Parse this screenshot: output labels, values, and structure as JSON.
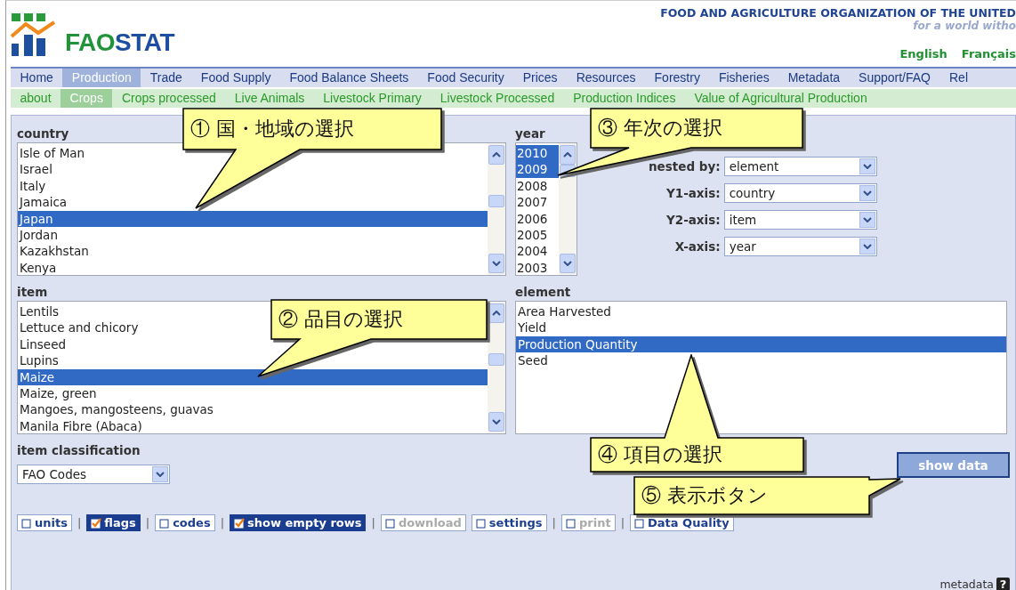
{
  "header": {
    "logo_text": [
      "FAO",
      "STAT"
    ],
    "organization": "FOOD AND AGRICULTURE ORGANIZATION OF THE UNITED",
    "tagline": "for a world witho",
    "languages": [
      {
        "label": "English"
      },
      {
        "label": "Français"
      }
    ]
  },
  "nav": [
    {
      "label": "Home",
      "selected": false
    },
    {
      "label": "Production",
      "selected": true
    },
    {
      "label": "Trade",
      "selected": false
    },
    {
      "label": "Food Supply",
      "selected": false
    },
    {
      "label": "Food Balance Sheets",
      "selected": false
    },
    {
      "label": "Food Security",
      "selected": false
    },
    {
      "label": "Prices",
      "selected": false
    },
    {
      "label": "Resources",
      "selected": false
    },
    {
      "label": "Forestry",
      "selected": false
    },
    {
      "label": "Fisheries",
      "selected": false
    },
    {
      "label": "Metadata",
      "selected": false
    },
    {
      "label": "Support/FAQ",
      "selected": false
    },
    {
      "label": "Rel",
      "selected": false
    }
  ],
  "subnav": [
    {
      "label": "about",
      "selected": false
    },
    {
      "label": "Crops",
      "selected": true
    },
    {
      "label": "Crops processed",
      "selected": false
    },
    {
      "label": "Live Animals",
      "selected": false
    },
    {
      "label": "Livestock Primary",
      "selected": false
    },
    {
      "label": "Livestock Processed",
      "selected": false
    },
    {
      "label": "Production Indices",
      "selected": false
    },
    {
      "label": "Value of Agricultural Production",
      "selected": false
    }
  ],
  "country": {
    "label": "country",
    "items": [
      {
        "label": "Isle of Man",
        "selected": false
      },
      {
        "label": "Israel",
        "selected": false
      },
      {
        "label": "Italy",
        "selected": false
      },
      {
        "label": "Jamaica",
        "selected": false
      },
      {
        "label": "Japan",
        "selected": true
      },
      {
        "label": "Jordan",
        "selected": false
      },
      {
        "label": "Kazakhstan",
        "selected": false
      },
      {
        "label": "Kenya",
        "selected": false
      }
    ]
  },
  "year": {
    "label": "year",
    "items": [
      {
        "label": "2010",
        "selected": true
      },
      {
        "label": "2009",
        "selected": true
      },
      {
        "label": "2008",
        "selected": false
      },
      {
        "label": "2007",
        "selected": false
      },
      {
        "label": "2006",
        "selected": false
      },
      {
        "label": "2005",
        "selected": false
      },
      {
        "label": "2004",
        "selected": false
      },
      {
        "label": "2003",
        "selected": false
      }
    ]
  },
  "axes": [
    {
      "label": "nested by:",
      "value": "element"
    },
    {
      "label": "Y1-axis:",
      "value": "country"
    },
    {
      "label": "Y2-axis:",
      "value": "item"
    },
    {
      "label": "X-axis:",
      "value": "year"
    }
  ],
  "item": {
    "label": "item",
    "items": [
      {
        "label": "Lentils",
        "selected": false
      },
      {
        "label": "Lettuce and chicory",
        "selected": false
      },
      {
        "label": "Linseed",
        "selected": false
      },
      {
        "label": "Lupins",
        "selected": false
      },
      {
        "label": "Maize",
        "selected": true
      },
      {
        "label": "Maize, green",
        "selected": false
      },
      {
        "label": "Mangoes, mangosteens, guavas",
        "selected": false
      },
      {
        "label": "Manila Fibre (Abaca)",
        "selected": false
      }
    ]
  },
  "element": {
    "label": "element",
    "items": [
      {
        "label": "Area Harvested",
        "selected": false
      },
      {
        "label": "Yield",
        "selected": false
      },
      {
        "label": "Production Quantity",
        "selected": true
      },
      {
        "label": "Seed",
        "selected": false
      }
    ]
  },
  "classification": {
    "label": "item classification",
    "value": "FAO Codes"
  },
  "show_data": "show data",
  "options": [
    {
      "label": "units",
      "checked": false,
      "disabled": false,
      "separator": "|"
    },
    {
      "label": "flags",
      "checked": true,
      "disabled": false,
      "separator": "|"
    },
    {
      "label": "codes",
      "checked": false,
      "disabled": false,
      "separator": "|"
    },
    {
      "label": "show empty rows",
      "checked": true,
      "disabled": false,
      "separator": "|"
    },
    {
      "label": "download",
      "checked": false,
      "disabled": true
    },
    {
      "label": "settings",
      "checked": false,
      "disabled": false,
      "separator": "|"
    },
    {
      "label": "print",
      "checked": false,
      "disabled": true,
      "separator": "|"
    },
    {
      "label": "Data Quality",
      "checked": false,
      "disabled": false
    }
  ],
  "metadata": {
    "label": "metadata",
    "icon": "?"
  },
  "callouts": [
    {
      "text": "① 国・地域の選択"
    },
    {
      "text": "③ 年次の選択"
    },
    {
      "text": "② 品目の選択"
    },
    {
      "text": "④ 項目の選択"
    },
    {
      "text": "⑤ 表示ボタン"
    }
  ]
}
